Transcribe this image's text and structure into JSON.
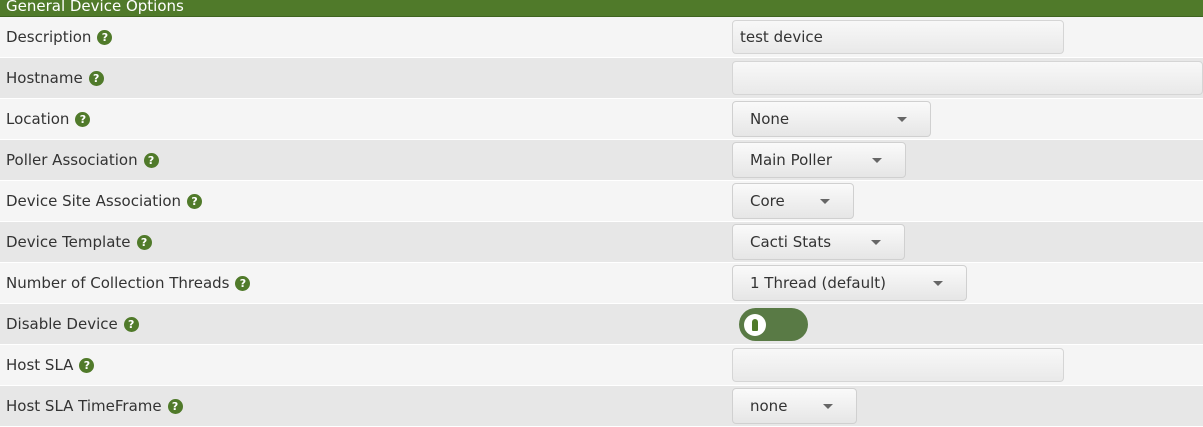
{
  "section": {
    "title": "General Device Options"
  },
  "rows": [
    {
      "label": "Description",
      "type": "text",
      "value": "test device"
    },
    {
      "label": "Hostname",
      "type": "text",
      "value": ""
    },
    {
      "label": "Location",
      "type": "select",
      "value": "None"
    },
    {
      "label": "Poller Association",
      "type": "select",
      "value": "Main Poller"
    },
    {
      "label": "Device Site Association",
      "type": "select",
      "value": "Core"
    },
    {
      "label": "Device Template",
      "type": "select",
      "value": "Cacti Stats"
    },
    {
      "label": "Number of Collection Threads",
      "type": "select",
      "value": "1 Thread (default)"
    },
    {
      "label": "Disable Device",
      "type": "toggle",
      "value": ""
    },
    {
      "label": "Host SLA",
      "type": "text",
      "value": ""
    },
    {
      "label": "Host SLA TimeFrame",
      "type": "select",
      "value": "none"
    }
  ],
  "help_icon": "?",
  "toggle_state": "off",
  "colors": {
    "header": "#507a2a",
    "accent": "#597a45"
  }
}
